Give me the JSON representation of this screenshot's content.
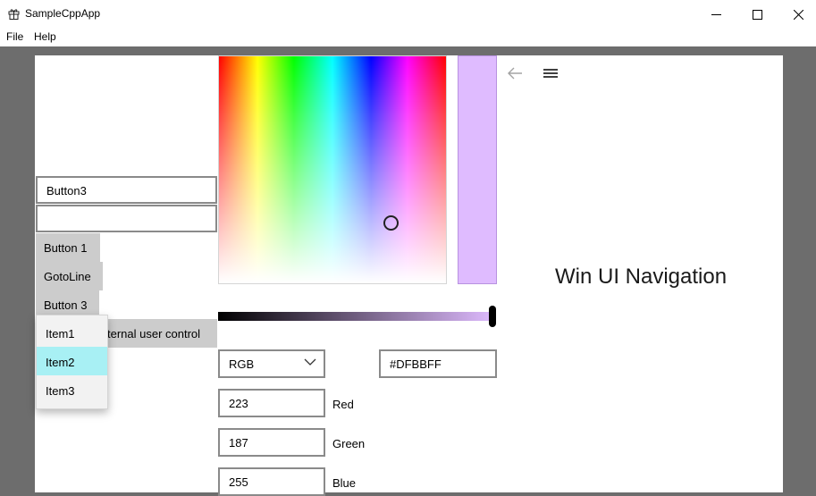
{
  "window": {
    "title": "SampleCppApp",
    "icon": "gift-icon",
    "controls": [
      "minimize-icon",
      "maximize-icon",
      "close-icon"
    ]
  },
  "menu": {
    "file": "File",
    "help": "Help"
  },
  "left": {
    "textbox_value": "Button3",
    "empty_textbox_value": "",
    "button1": "Button 1",
    "gotoline": "GotoLine",
    "button3": "Button 3",
    "internal_control": "ternal user control",
    "dropdown_items": [
      "Item1",
      "Item2",
      "Item3"
    ],
    "dropdown_selected": "Item2"
  },
  "color_picker": {
    "color_hex": "#DFBBFF",
    "hex_value": "#DFBBFF",
    "mode": "RGB",
    "red": "223",
    "green": "187",
    "blue": "255",
    "red_label": "Red",
    "green_label": "Green",
    "blue_label": "Blue",
    "value_slider_level": 1.0
  },
  "navigation": {
    "back_icon": "back-arrow-icon",
    "menu_icon": "hamburger-icon",
    "title": "Win UI Navigation"
  }
}
